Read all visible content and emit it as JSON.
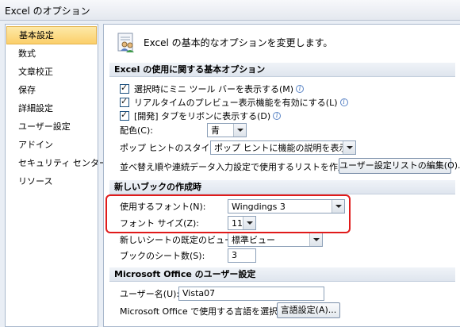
{
  "window": {
    "title": "Excel のオプション"
  },
  "sidebar": {
    "items": [
      {
        "label": "基本設定",
        "selected": true
      },
      {
        "label": "数式"
      },
      {
        "label": "文章校正"
      },
      {
        "label": "保存"
      },
      {
        "label": "詳細設定"
      },
      {
        "label": "ユーザー設定"
      },
      {
        "label": "アドイン"
      },
      {
        "label": "セキュリティ センター"
      },
      {
        "label": "リソース"
      }
    ]
  },
  "header": {
    "text": "Excel の基本的なオプションを変更します。"
  },
  "section1": {
    "title": "Excel の使用に関する基本オプション",
    "mini_toolbar": {
      "label": "選択時にミニ ツール バーを表示する(M)",
      "checked": true
    },
    "live_preview": {
      "label": "リアルタイムのプレビュー表示機能を有効にする(L)",
      "checked": true
    },
    "developer_tab": {
      "label": "[開発] タブをリボンに表示する(D)",
      "checked": true
    },
    "color": {
      "label": "配色(C):",
      "value": "青"
    },
    "tooltip_style": {
      "label": "ポップ ヒントのスタイル(R):",
      "value": "ポップ ヒントに機能の説明を表示する"
    },
    "custom_list": {
      "label": "並べ替え順や連続データ入力設定で使用するリストを作成します:",
      "button": "ユーザー設定リストの編集(O)..."
    }
  },
  "section2": {
    "title": "新しいブックの作成時",
    "font": {
      "label": "使用するフォント(N):",
      "value": "Wingdings 3"
    },
    "font_size": {
      "label": "フォント サイズ(Z):",
      "value": "11"
    },
    "default_view": {
      "label": "新しいシートの既定のビュー(V):",
      "value": "標準ビュー"
    },
    "sheet_count": {
      "label": "ブックのシート数(S):",
      "value": "3"
    }
  },
  "section3": {
    "title": "Microsoft Office のユーザー設定",
    "user_name": {
      "label": "ユーザー名(U):",
      "value": "Vista07"
    },
    "language": {
      "label": "Microsoft Office で使用する言語を選択する",
      "button": "言語設定(A)..."
    }
  },
  "colors": {
    "highlight": "#e01a1a",
    "accent": "#fbcf6a"
  }
}
